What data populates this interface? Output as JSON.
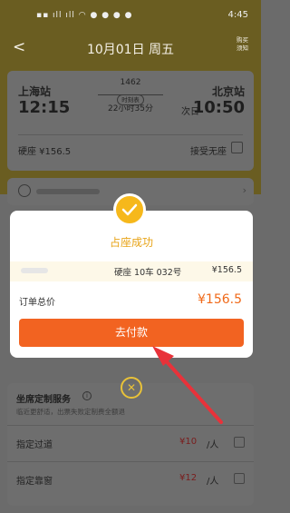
{
  "status_bar": {
    "time": "4:45"
  },
  "header": {
    "back": "<",
    "title": "10月01日 周五",
    "share": [
      "购买",
      "须知"
    ]
  },
  "trip": {
    "from_station": "上海站",
    "from_time": "12:15",
    "train_no": "1462",
    "schedule_label": "时刻表",
    "duration": "22小时35分",
    "next_day": "次日",
    "to_station": "北京站",
    "to_time": "10:50",
    "seat_price": "硬座 ¥156.5",
    "accept_label": "接受无座"
  },
  "modal": {
    "title": "占座成功",
    "seat": "硬座 10车 032号",
    "ticket_price": "¥156.5",
    "total_label": "订单总价",
    "total_value": "¥156.5",
    "pay_button": "去付款",
    "close": "✕"
  },
  "service": {
    "title": "坐席定制服务",
    "subtitle": "临近更舒适，出票失败定制费全额退",
    "rows": [
      {
        "name": "指定过道",
        "price": "¥10",
        "unit": "/人"
      },
      {
        "name": "指定靠窗",
        "price": "¥12",
        "unit": "/人"
      }
    ]
  },
  "colors": {
    "accent_orange": "#f26321",
    "success_yellow": "#f6b81b",
    "overlay": "#6b6b6b"
  }
}
